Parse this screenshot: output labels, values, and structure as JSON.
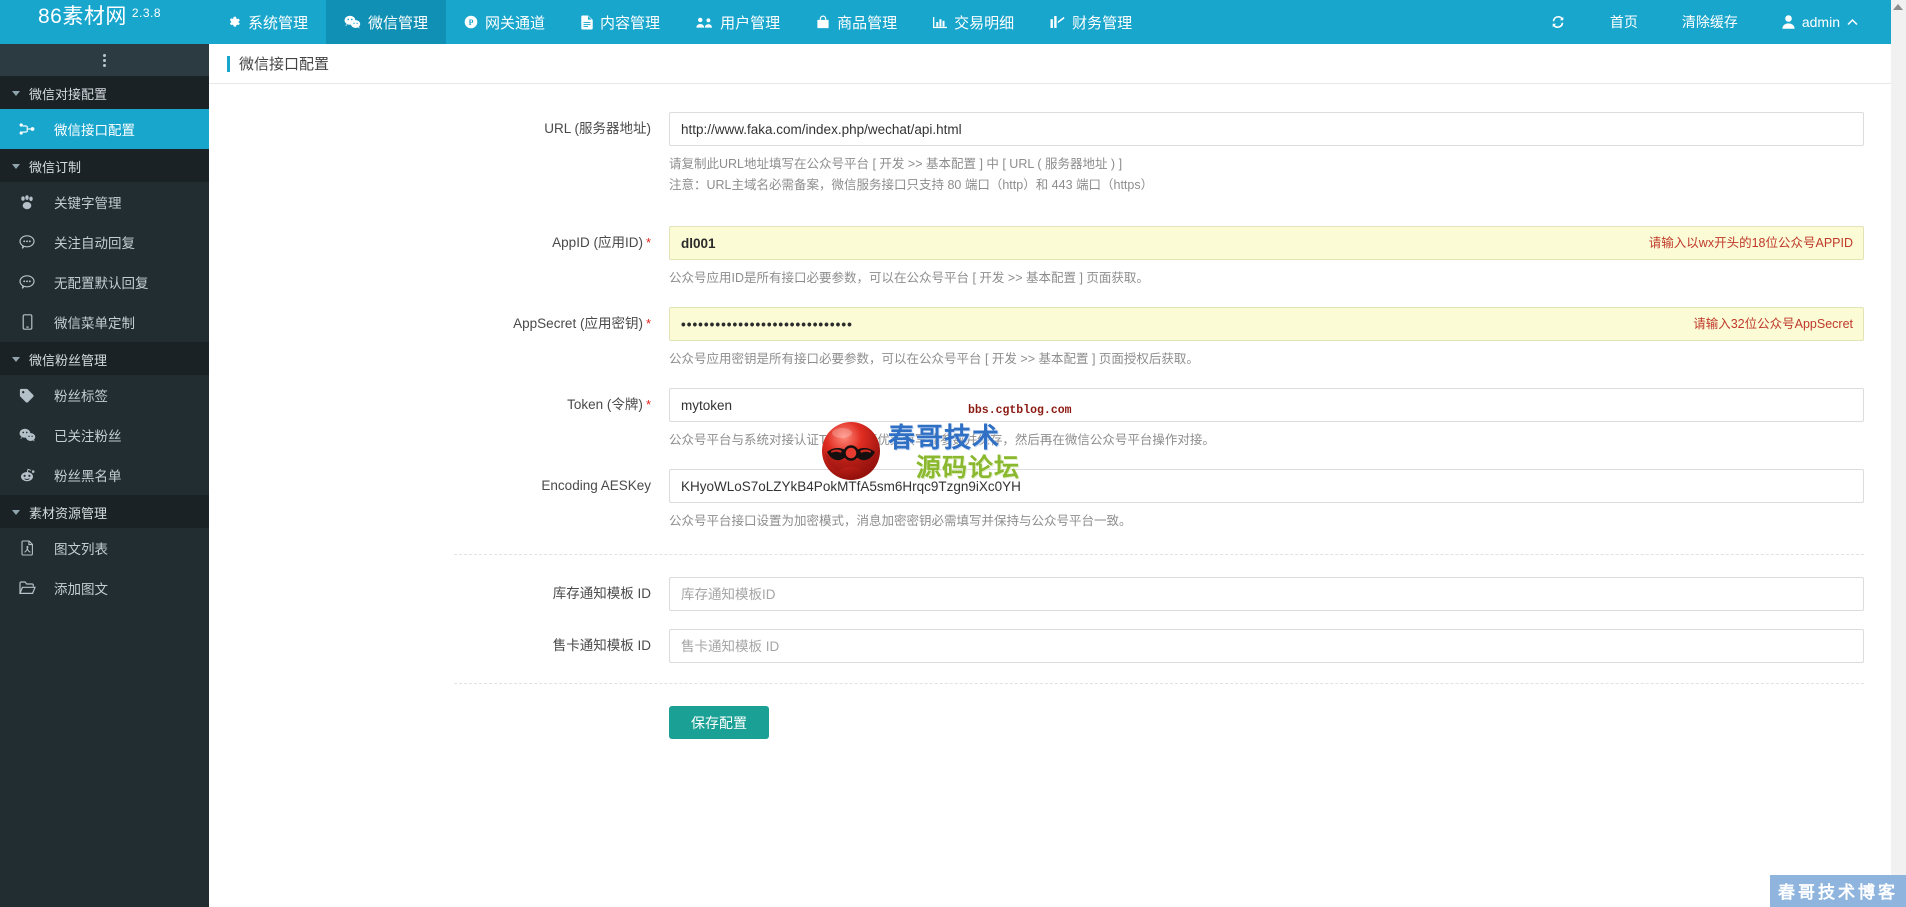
{
  "brand": {
    "name": "86素材网",
    "version": "2.3.8"
  },
  "navbar": {
    "items": [
      {
        "label": "系统管理",
        "icon": "gear-icon",
        "active": false
      },
      {
        "label": "微信管理",
        "icon": "wechat-icon",
        "active": true
      },
      {
        "label": "网关通道",
        "icon": "payment-icon",
        "active": false
      },
      {
        "label": "内容管理",
        "icon": "file-icon",
        "active": false
      },
      {
        "label": "用户管理",
        "icon": "users-icon",
        "active": false
      },
      {
        "label": "商品管理",
        "icon": "bag-icon",
        "active": false
      },
      {
        "label": "交易明细",
        "icon": "bar-chart-icon",
        "active": false
      },
      {
        "label": "财务管理",
        "icon": "finance-icon",
        "active": false
      }
    ],
    "right": {
      "refresh_icon": "refresh-icon",
      "home_label": "首页",
      "clear_cache_label": "清除缓存",
      "user_label": "admin",
      "user_icon": "user-icon",
      "chevron": "chevron-up-icon"
    }
  },
  "sidebar": {
    "groups": [
      {
        "title": "微信对接配置",
        "items": [
          {
            "label": "微信接口配置",
            "icon": "sitemap-icon",
            "active": true
          }
        ]
      },
      {
        "title": "微信订制",
        "items": [
          {
            "label": "关键字管理",
            "icon": "paw-icon",
            "active": false
          },
          {
            "label": "关注自动回复",
            "icon": "comment-icon",
            "active": false
          },
          {
            "label": "无配置默认回复",
            "icon": "comment-icon",
            "active": false
          },
          {
            "label": "微信菜单定制",
            "icon": "mobile-icon",
            "active": false
          }
        ]
      },
      {
        "title": "微信粉丝管理",
        "items": [
          {
            "label": "粉丝标签",
            "icon": "tag-icon",
            "active": false
          },
          {
            "label": "已关注粉丝",
            "icon": "wechat-icon",
            "active": false
          },
          {
            "label": "粉丝黑名单",
            "icon": "reddit-icon",
            "active": false
          }
        ]
      },
      {
        "title": "素材资源管理",
        "items": [
          {
            "label": "图文列表",
            "icon": "file-pdf-icon",
            "active": false
          },
          {
            "label": "添加图文",
            "icon": "folder-open-icon",
            "active": false
          }
        ]
      }
    ]
  },
  "page": {
    "title": "微信接口配置"
  },
  "form": {
    "url": {
      "label": "URL (服务器地址)",
      "value": "http://www.faka.com/index.php/wechat/api.html",
      "help1": "请复制此URL地址填写在公众号平台 [ 开发 >> 基本配置 ] 中 [ URL ( 服务器地址 ) ]",
      "help2": "注意：URL主域名必需备案，微信服务接口只支持 80 端口（http）和 443 端口（https）"
    },
    "appid": {
      "label": "AppID (应用ID)",
      "required": "*",
      "value": "dl001",
      "warning": "请输入以wx开头的18位公众号APPID",
      "help": "公众号应用ID是所有接口必要参数，可以在公众号平台 [ 开发 >> 基本配置 ] 页面获取。"
    },
    "appsecret": {
      "label": "AppSecret (应用密钥)",
      "required": "*",
      "value": "••••••••••••••••••••••••••••••",
      "warning": "请输入32位公众号AppSecret",
      "help": "公众号应用密钥是所有接口必要参数，可以在公众号平台 [ 开发 >> 基本配置 ] 页面授权后获取。"
    },
    "token": {
      "label": "Token (令牌)",
      "required": "*",
      "value": "mytoken",
      "help": "公众号平台与系统对接认证Token，请优先填写此参数并保存，然后再在微信公众号平台操作对接。"
    },
    "aeskey": {
      "label": "Encoding AESKey",
      "value": "KHyoWLoS7oLZYkB4PokMTfA5sm6Hrqc9Tzgn9iXc0YH",
      "help": "公众号平台接口设置为加密模式，消息加密密钥必需填写并保持与公众号平台一致。"
    },
    "stock_template": {
      "label": "库存通知模板 ID",
      "value": "",
      "placeholder": "库存通知模板ID"
    },
    "card_template": {
      "label": "售卡通知模板 ID",
      "value": "",
      "placeholder": "售卡通知模板 ID"
    },
    "save_label": "保存配置"
  },
  "watermark": {
    "text_blue": "春哥技术",
    "text_green": "源码论坛",
    "url": "bbs.cgtblog.com",
    "corner": "春哥技术博客"
  },
  "colors": {
    "nav_bg": "#18a6cd",
    "nav_active": "#0f90b4",
    "sidebar_bg": "#222d32",
    "sidebar_header": "#1a2226",
    "sidebar_active": "#18a6cd",
    "accent": "#18a6cd",
    "save_button": "#1aa094",
    "warn_bg": "#fbfbd5",
    "warn_text": "#c0392b",
    "required": "#e2231a"
  }
}
